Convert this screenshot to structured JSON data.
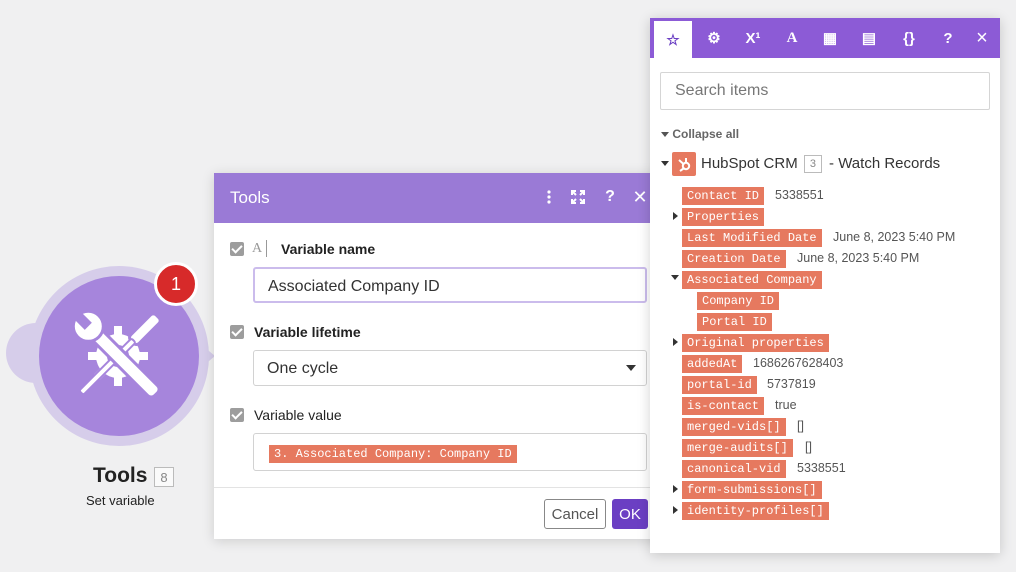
{
  "module": {
    "title": "Tools",
    "number": "8",
    "subtitle": "Set variable",
    "badge": "1",
    "icon": "tools-icon"
  },
  "dialog": {
    "title": "Tools",
    "fields": {
      "variable_name": {
        "label": "Variable name",
        "value": "Associated Company ID"
      },
      "variable_lifetime": {
        "label": "Variable lifetime",
        "value": "One cycle"
      },
      "variable_value": {
        "label": "Variable value",
        "pill": "3. Associated Company: Company ID"
      }
    },
    "cancel_label": "Cancel",
    "ok_label": "OK",
    "header_icons": [
      "kebab-menu-icon",
      "expand-icon",
      "help-icon",
      "close-icon"
    ]
  },
  "panel": {
    "tabs": [
      {
        "icon": "star-icon",
        "glyph": "☆"
      },
      {
        "icon": "gear-icon",
        "glyph": "⚙"
      },
      {
        "icon": "superscript-icon",
        "glyph": "X¹"
      },
      {
        "icon": "text-icon",
        "glyph": "A"
      },
      {
        "icon": "calendar-icon",
        "glyph": "▦"
      },
      {
        "icon": "table-icon",
        "glyph": "▤"
      },
      {
        "icon": "braces-icon",
        "glyph": "{}"
      }
    ],
    "help": "?",
    "close": "×",
    "search_placeholder": "Search items",
    "collapse_all": "Collapse all",
    "root": {
      "name": "HubSpot CRM",
      "number": "3",
      "suffix": "- Watch Records"
    },
    "items": [
      {
        "key": "Contact ID",
        "value": "5338551"
      },
      {
        "key": "Properties",
        "value": ""
      },
      {
        "key": "Last Modified Date",
        "value": "June 8, 2023 5:40 PM"
      },
      {
        "key": "Creation Date",
        "value": "June 8, 2023 5:40 PM"
      },
      {
        "key": "Associated Company",
        "value": ""
      },
      {
        "key": "Company ID",
        "value": ""
      },
      {
        "key": "Portal ID",
        "value": ""
      },
      {
        "key": "Original properties",
        "value": ""
      },
      {
        "key": "addedAt",
        "value": "1686267628403"
      },
      {
        "key": "portal-id",
        "value": "5737819"
      },
      {
        "key": "is-contact",
        "value": "true"
      },
      {
        "key": "merged-vids[]",
        "value": "[]"
      },
      {
        "key": "merge-audits[]",
        "value": "[]"
      },
      {
        "key": "canonical-vid",
        "value": "5338551"
      },
      {
        "key": "form-submissions[]",
        "value": ""
      },
      {
        "key": "identity-profiles[]",
        "value": ""
      }
    ]
  },
  "colors": {
    "accent": "#8c5bd6",
    "dialog_header": "#9a7ad6",
    "pill": "#e6795f",
    "ok_button": "#6b3fc3",
    "badge": "#d72a2a"
  }
}
